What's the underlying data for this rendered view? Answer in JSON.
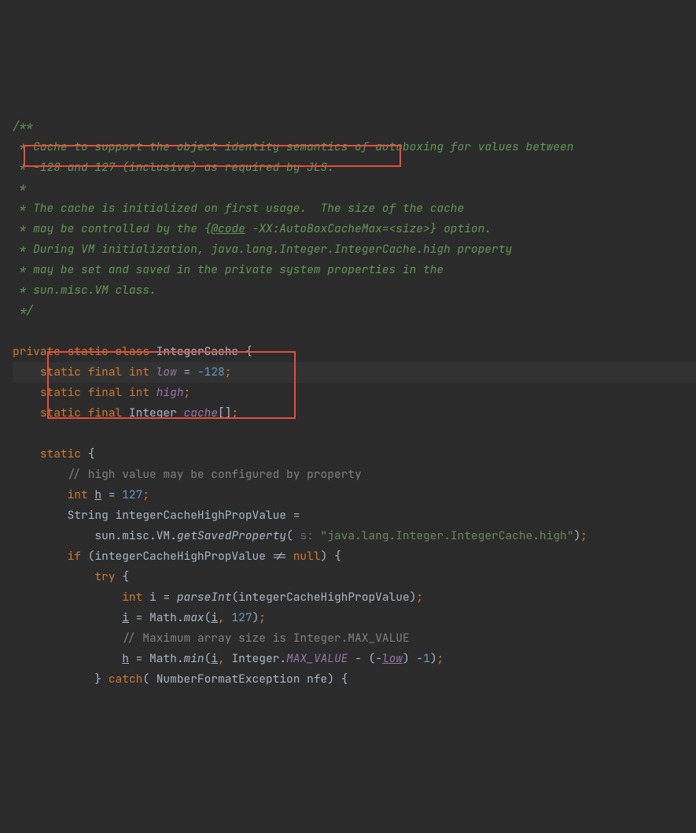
{
  "doc": {
    "l1": "/**",
    "l2": " * Cache to support the object identity semantics of autoboxing for values between",
    "l3": " * -128 and 127 (inclusive) as required by JLS.",
    "l4": " *",
    "l5": " * The cache is initialized on first usage.  The size of the cache",
    "l6a": " * may be controlled by the {",
    "l6link": "@code",
    "l6b": " -XX:AutoBoxCacheMax=<size>} option.",
    "l7": " * During VM initialization, java.lang.Integer.IntegerCache.high property",
    "l8": " * may be set and saved in the private system properties in the",
    "l9": " * sun.misc.VM class.",
    "l10": " */"
  },
  "kw": {
    "private": "private",
    "static": "static",
    "class": "class",
    "final": "final",
    "int": "int",
    "if": "if",
    "null": "null",
    "try": "try",
    "catch": "catch"
  },
  "id": {
    "IntegerCache": "IntegerCache",
    "low": "low",
    "high": "high",
    "cache": "cache",
    "Integer": "Integer",
    "h": "h",
    "String": "String",
    "integerCacheHighPropValue": "integerCacheHighPropValue",
    "sun_misc_VM": "sun.misc.VM.",
    "getSavedProperty": "getSavedProperty",
    "parseInt": "parseInt",
    "Math": "Math",
    "max": "max",
    "min": "min",
    "MAX_VALUE": "MAX_VALUE",
    "NumberFormatException": "NumberFormatException",
    "nfe": "nfe",
    "i": "i"
  },
  "num": {
    "n128": "128",
    "n127": "127",
    "n1": "1"
  },
  "str": {
    "prop": "\"java.lang.Integer.IntegerCache.high\""
  },
  "cmt": {
    "c1": "// high value may be configured by property",
    "c2": "// Maximum array size is Integer.MAX_VALUE"
  },
  "hint": {
    "s": " s: "
  },
  "punct": {
    "obrace": " {",
    "cbrace": "}",
    "eq": " = ",
    "semi": ";",
    "comma": ", ",
    "op": "(",
    "cp": ")",
    "sqb": "[]",
    "minus": "-",
    "neq": " != ",
    "sub": " - ",
    "space": " "
  }
}
